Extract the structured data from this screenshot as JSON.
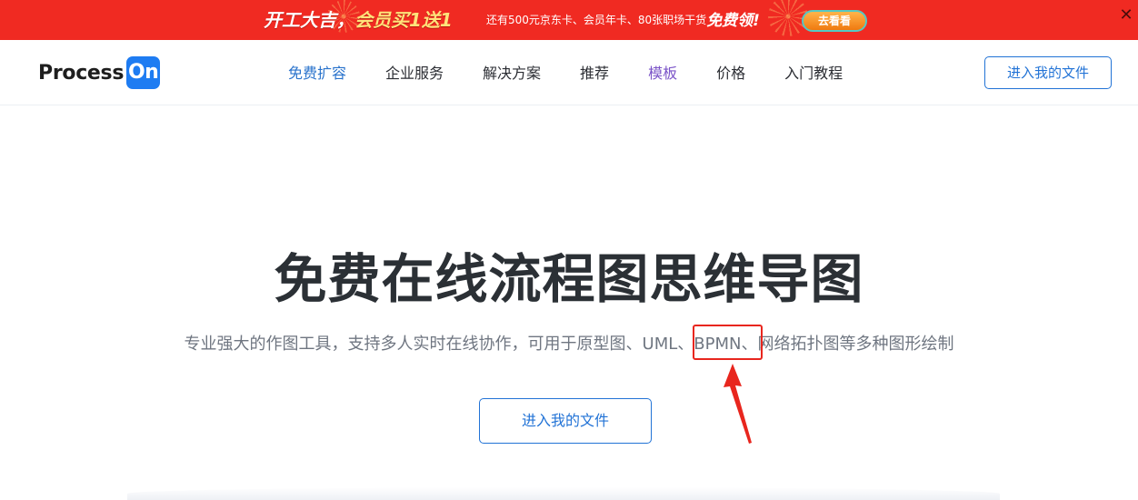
{
  "promo": {
    "title_part1": "开工大吉，",
    "title_part2": "会员买1送1",
    "subtitle": "还有500元京东卡、会员年卡、80张职场干货",
    "subtitle_emph": "免费领!",
    "button_label": "去看看",
    "close_label": "✕"
  },
  "header": {
    "logo_text": "Process",
    "logo_badge": "On",
    "nav": [
      {
        "label": "免费扩容"
      },
      {
        "label": "企业服务"
      },
      {
        "label": "解决方案"
      },
      {
        "label": "推荐"
      },
      {
        "label": "模板"
      },
      {
        "label": "价格"
      },
      {
        "label": "入门教程"
      }
    ],
    "cta_label": "进入我的文件"
  },
  "hero": {
    "title": "免费在线流程图思维导图",
    "subtitle": "专业强大的作图工具，支持多人实时在线协作，可用于原型图、UML、BPMN、网络拓扑图等多种图形绘制",
    "cta_label": "进入我的文件"
  },
  "colors": {
    "promo_bg": "#f02a22",
    "brand_blue": "#2273d6",
    "nav_highlight_blue": "#2a73cc",
    "nav_highlight_purple": "#7b54c8",
    "annotation_red": "#e8261e"
  },
  "icons": {
    "close": "close-icon",
    "annotation_arrow": "arrow-up-icon"
  }
}
